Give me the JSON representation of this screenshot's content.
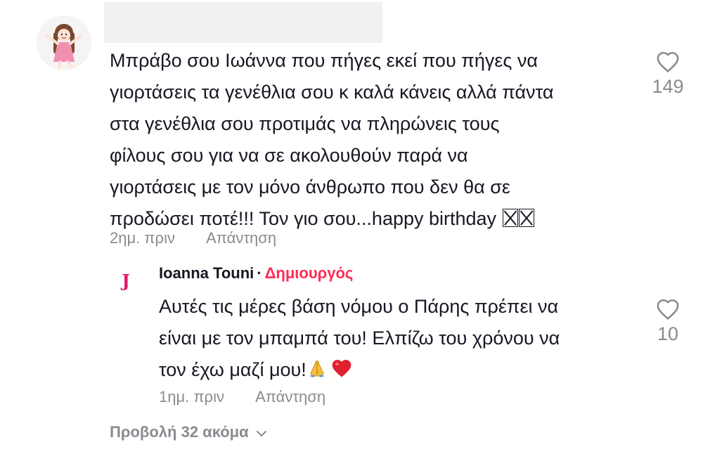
{
  "comment": {
    "text": "Μπράβο σου Ιωάννα που πήγες εκεί που πήγες να\nγιορτάσεις τα γενέθλια σου κ καλά κάνεις αλλά πάντα\nστα γενέθλια σου προτιμάς να πληρώνεις τους\nφίλους σου για να σε ακολουθούν παρά να\nγιορτάσεις με τον μόνο άνθρωπο που δεν θα σε\nπροδώσει ποτέ!!! Τον γιο σου...happy birthday ",
    "time": "2ημ. πριν",
    "reply_label": "Απάντηση",
    "like_count": "149"
  },
  "reply": {
    "avatar_letter": "J",
    "author": "Ioanna Touni",
    "separator": "·",
    "badge": "Δημιουργός",
    "text": "Αυτές τις μέρες βάση νόμου ο Πάρης πρέπει να\nείναι με τον μπαμπά του! Ελπίζω του χρόνου να\nτον έχω μαζί μου!",
    "time": "1ημ. πριν",
    "reply_label": "Απάντηση",
    "like_count": "10"
  },
  "view_more": {
    "label": "Προβολή 32 ακόμα"
  },
  "icons": {
    "like": "heart-outline-icon",
    "expand": "chevron-down-icon",
    "pray": "folded-hands-emoji",
    "heart": "red-heart-emoji"
  },
  "colors": {
    "text": "#161823",
    "muted": "#8a8b91",
    "creator": "#fe2c55",
    "avatar_letter": "#e2186a"
  }
}
